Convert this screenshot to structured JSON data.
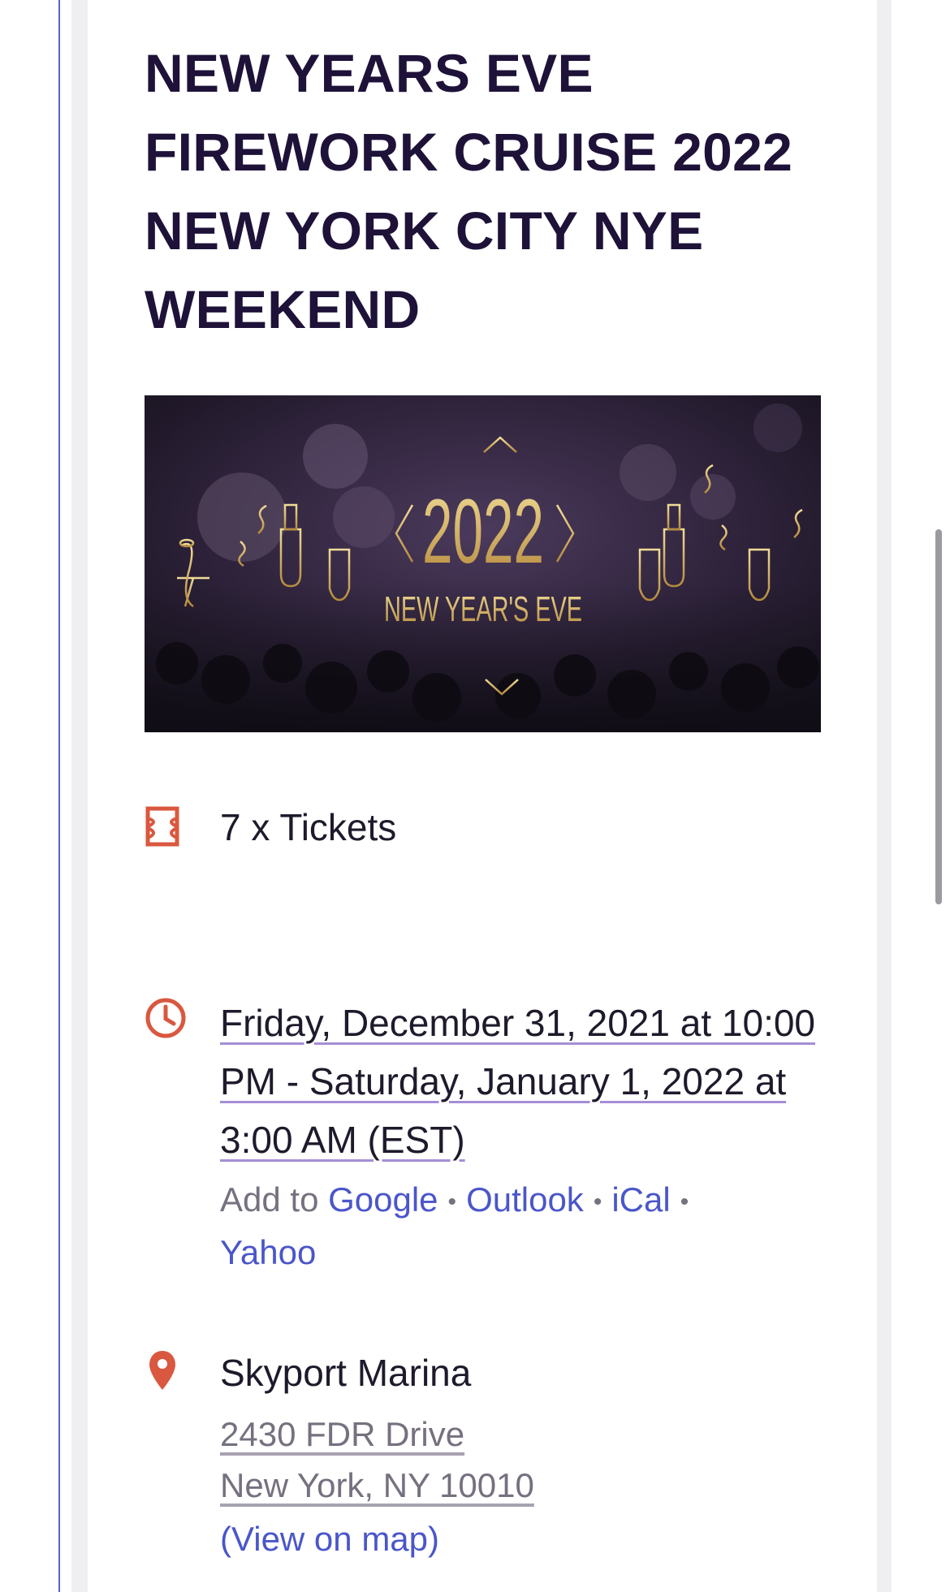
{
  "event": {
    "title": "NEW YEARS EVE FIREWORK CRUISE 2022 NEW YORK CITY NYE WEEKEND",
    "banner": {
      "year": "2022",
      "subtitle": "NEW YEAR'S EVE"
    },
    "tickets": {
      "icon": "ticket-icon",
      "label": "7 x Tickets"
    },
    "datetime": {
      "icon": "clock-icon",
      "text": "Friday, December 31, 2021 at 10:00 PM - Saturday, January 1, 2022 at 3:00 AM (EST)",
      "add_to_label": "Add to",
      "calendars": [
        "Google",
        "Outlook",
        "iCal",
        "Yahoo"
      ]
    },
    "location": {
      "icon": "map-pin-icon",
      "venue": "Skyport Marina",
      "address_line1": "2430 FDR Drive",
      "address_line2": "New York, NY 10010",
      "map_link": "(View on map)"
    }
  },
  "colors": {
    "title": "#1e1239",
    "accent_icon": "#d9583f",
    "link": "#4a56c9",
    "muted": "#76707f"
  }
}
